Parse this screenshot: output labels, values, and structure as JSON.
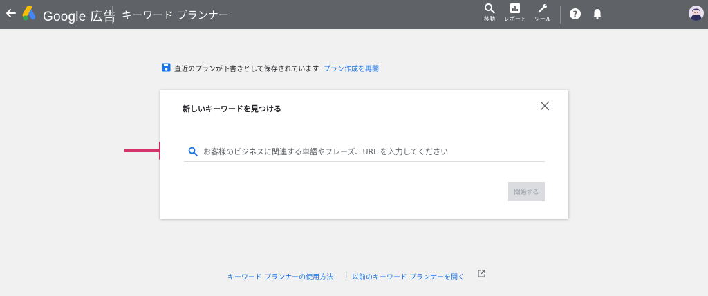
{
  "header": {
    "brand_name": "Google 広告",
    "tool_title": "キーワード プランナー",
    "nav": [
      {
        "label": "移動",
        "icon": "search-icon"
      },
      {
        "label": "レポート",
        "icon": "reports-icon"
      },
      {
        "label": "ツール",
        "icon": "wrench-icon"
      }
    ],
    "help_icon": "help-icon",
    "bell_icon": "notifications-icon",
    "background": "#5f6368"
  },
  "notice": {
    "text": "直近のプランが下書きとして保存されています",
    "link": "プラン作成を再開",
    "icon": "save-icon",
    "icon_color": "#1a73e8"
  },
  "card": {
    "title": "新しいキーワードを見つける",
    "search_placeholder": "お客様のビジネスに関連する単語やフレーズ、URL を入力してください",
    "search_value": "",
    "start_button": "開始する"
  },
  "annotation": {
    "arrow_color": "#d6336c"
  },
  "footer": {
    "link1": "キーワード プランナーの使用方法",
    "separator": "|",
    "link2": "以前のキーワード プランナーを開く"
  }
}
